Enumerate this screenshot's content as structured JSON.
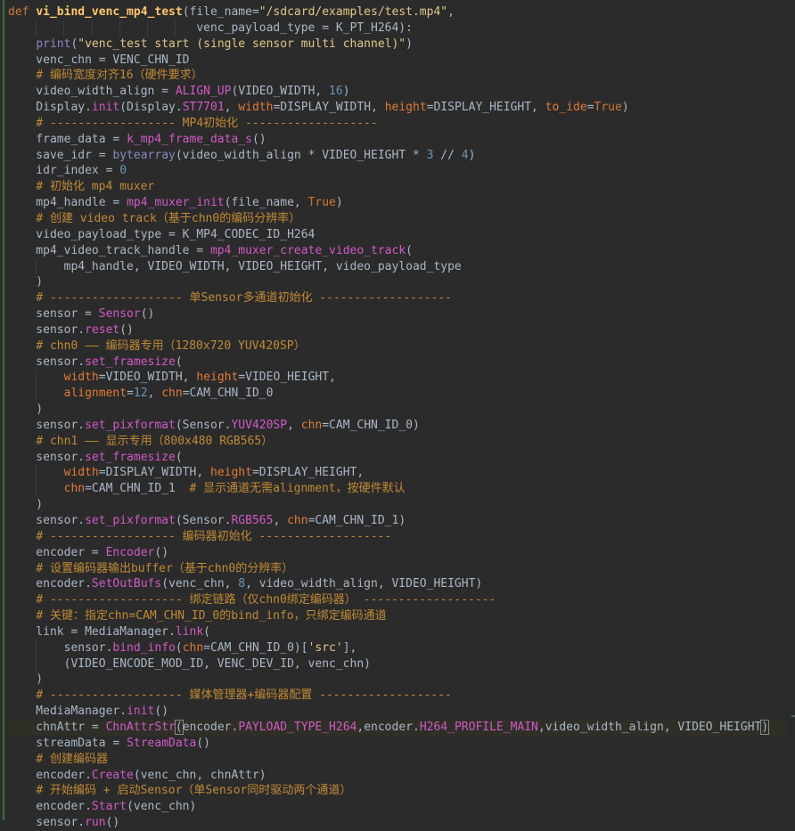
{
  "editor": {
    "language": "python",
    "colors": {
      "background": "#2b2b2b",
      "default": "#a9b7c6",
      "keyword": "#cc7832",
      "function_def": "#ffc66d",
      "string": "#e0c88a",
      "number": "#6897bb",
      "comment": "#c08a36",
      "builtin": "#8888c6",
      "call": "#d15ac5",
      "kwarg": "#e07a38"
    },
    "lines": [
      [
        [
          "kw",
          "def "
        ],
        [
          "fn",
          "vi_bind_venc_mp4_test"
        ],
        [
          "p",
          "(file_name="
        ],
        [
          "str",
          "\"/sdcard/examples/test.mp4\""
        ],
        [
          "p",
          ","
        ]
      ],
      [
        [
          "p",
          "                           venc_payload_type = K_PT_H264):"
        ]
      ],
      [
        [
          "p",
          "    "
        ],
        [
          "bi",
          "print"
        ],
        [
          "p",
          "("
        ],
        [
          "str",
          "\"venc_test start (single sensor multi channel)\""
        ],
        [
          "p",
          ")"
        ]
      ],
      [
        [
          "p",
          "    venc_chn = VENC_CHN_ID"
        ]
      ],
      [
        [
          "p",
          "    "
        ],
        [
          "cm",
          "# 编码宽度对齐16（硬件要求）"
        ]
      ],
      [
        [
          "p",
          "    video_width_align = "
        ],
        [
          "mc",
          "ALIGN_UP"
        ],
        [
          "p",
          "(VIDEO_WIDTH, "
        ],
        [
          "num",
          "16"
        ],
        [
          "p",
          ")"
        ]
      ],
      [
        [
          "p",
          "    Display."
        ],
        [
          "mc",
          "init"
        ],
        [
          "p",
          "(Display."
        ],
        [
          "attr",
          "ST7701"
        ],
        [
          "p",
          ", "
        ],
        [
          "kwarg",
          "width"
        ],
        [
          "p",
          "=DISPLAY_WIDTH, "
        ],
        [
          "kwarg",
          "height"
        ],
        [
          "p",
          "=DISPLAY_HEIGHT, "
        ],
        [
          "kwarg",
          "to_ide"
        ],
        [
          "p",
          "="
        ],
        [
          "kw",
          "True"
        ],
        [
          "p",
          ")"
        ]
      ],
      [
        [
          "p",
          "    "
        ],
        [
          "cm",
          "# ------------------ MP4初始化 -------------------"
        ]
      ],
      [
        [
          "p",
          "    frame_data = "
        ],
        [
          "mc",
          "k_mp4_frame_data_s"
        ],
        [
          "p",
          "()"
        ]
      ],
      [
        [
          "p",
          "    save_idr = "
        ],
        [
          "bi",
          "bytearray"
        ],
        [
          "p",
          "(video_width_align * VIDEO_HEIGHT * "
        ],
        [
          "num",
          "3"
        ],
        [
          "p",
          " // "
        ],
        [
          "num",
          "4"
        ],
        [
          "p",
          ")"
        ]
      ],
      [
        [
          "p",
          "    idr_index = "
        ],
        [
          "num",
          "0"
        ]
      ],
      [
        [
          "p",
          "    "
        ],
        [
          "cm",
          "# 初始化 mp4 muxer"
        ]
      ],
      [
        [
          "p",
          "    mp4_handle = "
        ],
        [
          "mc",
          "mp4_muxer_init"
        ],
        [
          "p",
          "(file_name, "
        ],
        [
          "kw",
          "True"
        ],
        [
          "p",
          ")"
        ]
      ],
      [
        [
          "p",
          "    "
        ],
        [
          "cm",
          "# 创建 video track（基于chn0的编码分辨率）"
        ]
      ],
      [
        [
          "p",
          "    video_payload_type = K_MP4_CODEC_ID_H264"
        ]
      ],
      [
        [
          "p",
          "    mp4_video_track_handle = "
        ],
        [
          "mc",
          "mp4_muxer_create_video_track"
        ],
        [
          "p",
          "("
        ]
      ],
      [
        [
          "p",
          "        mp4_handle, VIDEO_WIDTH, VIDEO_HEIGHT, video_payload_type"
        ]
      ],
      [
        [
          "p",
          "    )"
        ]
      ],
      [
        [
          "p",
          "    "
        ],
        [
          "cm",
          "# ------------------- 单Sensor多通道初始化 -------------------"
        ]
      ],
      [
        [
          "p",
          "    sensor = "
        ],
        [
          "mc",
          "Sensor"
        ],
        [
          "p",
          "()"
        ]
      ],
      [
        [
          "p",
          "    sensor."
        ],
        [
          "mc",
          "reset"
        ],
        [
          "p",
          "()"
        ]
      ],
      [
        [
          "p",
          "    "
        ],
        [
          "cm",
          "# chn0 —— 编码器专用（1280x720 YUV420SP）"
        ]
      ],
      [
        [
          "p",
          "    sensor."
        ],
        [
          "mc",
          "set_framesize"
        ],
        [
          "p",
          "("
        ]
      ],
      [
        [
          "p",
          "        "
        ],
        [
          "kwarg",
          "width"
        ],
        [
          "p",
          "=VIDEO_WIDTH, "
        ],
        [
          "kwarg",
          "height"
        ],
        [
          "p",
          "=VIDEO_HEIGHT,"
        ]
      ],
      [
        [
          "p",
          "        "
        ],
        [
          "kwarg",
          "alignment"
        ],
        [
          "p",
          "="
        ],
        [
          "num",
          "12"
        ],
        [
          "p",
          ", "
        ],
        [
          "kwarg",
          "chn"
        ],
        [
          "p",
          "=CAM_CHN_ID_0"
        ]
      ],
      [
        [
          "p",
          "    )"
        ]
      ],
      [
        [
          "p",
          "    sensor."
        ],
        [
          "mc",
          "set_pixformat"
        ],
        [
          "p",
          "(Sensor."
        ],
        [
          "attr",
          "YUV420SP"
        ],
        [
          "p",
          ", "
        ],
        [
          "kwarg",
          "chn"
        ],
        [
          "p",
          "=CAM_CHN_ID_0)"
        ]
      ],
      [
        [
          "p",
          "    "
        ],
        [
          "cm",
          "# chn1 —— 显示专用（800x480 RGB565）"
        ]
      ],
      [
        [
          "p",
          "    sensor."
        ],
        [
          "mc",
          "set_framesize"
        ],
        [
          "p",
          "("
        ]
      ],
      [
        [
          "p",
          "        "
        ],
        [
          "kwarg",
          "width"
        ],
        [
          "p",
          "=DISPLAY_WIDTH, "
        ],
        [
          "kwarg",
          "height"
        ],
        [
          "p",
          "=DISPLAY_HEIGHT,"
        ]
      ],
      [
        [
          "p",
          "        "
        ],
        [
          "kwarg",
          "chn"
        ],
        [
          "p",
          "=CAM_CHN_ID_1  "
        ],
        [
          "cm",
          "# 显示通道无需alignment，按硬件默认"
        ]
      ],
      [
        [
          "p",
          "    )"
        ]
      ],
      [
        [
          "p",
          "    sensor."
        ],
        [
          "mc",
          "set_pixformat"
        ],
        [
          "p",
          "(Sensor."
        ],
        [
          "attr",
          "RGB565"
        ],
        [
          "p",
          ", "
        ],
        [
          "kwarg",
          "chn"
        ],
        [
          "p",
          "=CAM_CHN_ID_1)"
        ]
      ],
      [
        [
          "p",
          "    "
        ],
        [
          "cm",
          "# ------------------ 编码器初始化 -------------------"
        ]
      ],
      [
        [
          "p",
          "    encoder = "
        ],
        [
          "mc",
          "Encoder"
        ],
        [
          "p",
          "()"
        ]
      ],
      [
        [
          "p",
          "    "
        ],
        [
          "cm",
          "# 设置编码器输出buffer（基于chn0的分辨率）"
        ]
      ],
      [
        [
          "p",
          "    encoder."
        ],
        [
          "mc",
          "SetOutBufs"
        ],
        [
          "p",
          "(venc_chn, "
        ],
        [
          "num",
          "8"
        ],
        [
          "p",
          ", video_width_align, VIDEO_HEIGHT)"
        ]
      ],
      [
        [
          "p",
          "    "
        ],
        [
          "cm",
          "# ------------------- 绑定链路（仅chn0绑定编码器） -------------------"
        ]
      ],
      [
        [
          "p",
          "    "
        ],
        [
          "cm",
          "# 关键：指定chn=CAM_CHN_ID_0的bind_info，只绑定编码通道"
        ]
      ],
      [
        [
          "p",
          "    link = MediaManager."
        ],
        [
          "mc",
          "link"
        ],
        [
          "p",
          "("
        ]
      ],
      [
        [
          "p",
          "        sensor."
        ],
        [
          "mc",
          "bind_info"
        ],
        [
          "p",
          "("
        ],
        [
          "kwarg",
          "chn"
        ],
        [
          "p",
          "=CAM_CHN_ID_0)["
        ],
        [
          "str",
          "'src'"
        ],
        [
          "p",
          "],"
        ]
      ],
      [
        [
          "p",
          "        (VIDEO_ENCODE_MOD_ID, VENC_DEV_ID, venc_chn)"
        ]
      ],
      [
        [
          "p",
          "    )"
        ]
      ],
      [
        [
          "p",
          "    "
        ],
        [
          "cm",
          "# ------------------- 媒体管理器+编码器配置 -------------------"
        ]
      ],
      [
        [
          "p",
          "    MediaManager."
        ],
        [
          "mc",
          "init"
        ],
        [
          "p",
          "()"
        ]
      ],
      [
        [
          "p",
          "    chnAttr = "
        ],
        [
          "mc",
          "ChnAttrStr"
        ],
        [
          "brace",
          "("
        ],
        [
          "p",
          "encoder."
        ],
        [
          "attr",
          "PAYLOAD_TYPE_H264"
        ],
        [
          "p",
          ",encoder."
        ],
        [
          "attr",
          "H264_PROFILE_MAIN"
        ],
        [
          "p",
          ",video_width_align, VIDEO_HEIGHT"
        ],
        [
          "brace",
          ")"
        ]
      ],
      [
        [
          "p",
          "    streamData = "
        ],
        [
          "mc",
          "StreamData"
        ],
        [
          "p",
          "()"
        ]
      ],
      [
        [
          "p",
          "    "
        ],
        [
          "cm",
          "# 创建编码器"
        ]
      ],
      [
        [
          "p",
          "    encoder."
        ],
        [
          "mc",
          "Create"
        ],
        [
          "p",
          "(venc_chn, chnAttr)"
        ]
      ],
      [
        [
          "p",
          "    "
        ],
        [
          "cm",
          "# 开始编码 + 启动Sensor（单Sensor同时驱动两个通道）"
        ]
      ],
      [
        [
          "p",
          "    encoder."
        ],
        [
          "mc",
          "Start"
        ],
        [
          "p",
          "(venc_chn)"
        ]
      ],
      [
        [
          "p",
          "    sensor."
        ],
        [
          "mc",
          "run"
        ],
        [
          "p",
          "()"
        ]
      ]
    ]
  }
}
